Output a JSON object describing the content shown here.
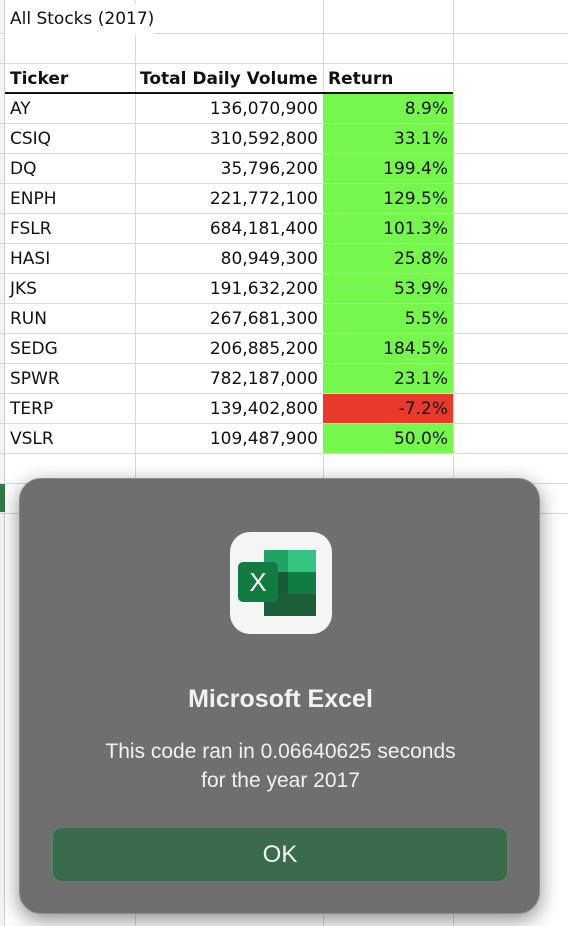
{
  "sheet": {
    "title": "All Stocks (2017)",
    "headers": {
      "ticker": "Ticker",
      "volume": "Total Daily Volume",
      "return": "Return"
    },
    "rows": [
      {
        "ticker": "AY",
        "volume": "136,070,900",
        "return": "8.9%",
        "status": "positive"
      },
      {
        "ticker": "CSIQ",
        "volume": "310,592,800",
        "return": "33.1%",
        "status": "positive"
      },
      {
        "ticker": "DQ",
        "volume": "35,796,200",
        "return": "199.4%",
        "status": "positive"
      },
      {
        "ticker": "ENPH",
        "volume": "221,772,100",
        "return": "129.5%",
        "status": "positive"
      },
      {
        "ticker": "FSLR",
        "volume": "684,181,400",
        "return": "101.3%",
        "status": "positive"
      },
      {
        "ticker": "HASI",
        "volume": "80,949,300",
        "return": "25.8%",
        "status": "positive"
      },
      {
        "ticker": "JKS",
        "volume": "191,632,200",
        "return": "53.9%",
        "status": "positive"
      },
      {
        "ticker": "RUN",
        "volume": "267,681,300",
        "return": "5.5%",
        "status": "positive"
      },
      {
        "ticker": "SEDG",
        "volume": "206,885,200",
        "return": "184.5%",
        "status": "positive"
      },
      {
        "ticker": "SPWR",
        "volume": "782,187,000",
        "return": "23.1%",
        "status": "positive"
      },
      {
        "ticker": "TERP",
        "volume": "139,402,800",
        "return": "-7.2%",
        "status": "negative"
      },
      {
        "ticker": "VSLR",
        "volume": "109,487,900",
        "return": "50.0%",
        "status": "positive"
      }
    ],
    "colors": {
      "positive": "#76f74d",
      "negative": "#e8392a"
    }
  },
  "dialog": {
    "app_icon": "microsoft-excel-icon",
    "title": "Microsoft Excel",
    "message_line1": "This code ran in 0.06640625 seconds",
    "message_line2": "for the year 2017",
    "ok_label": "OK",
    "accent_color": "#3a6b4c"
  }
}
